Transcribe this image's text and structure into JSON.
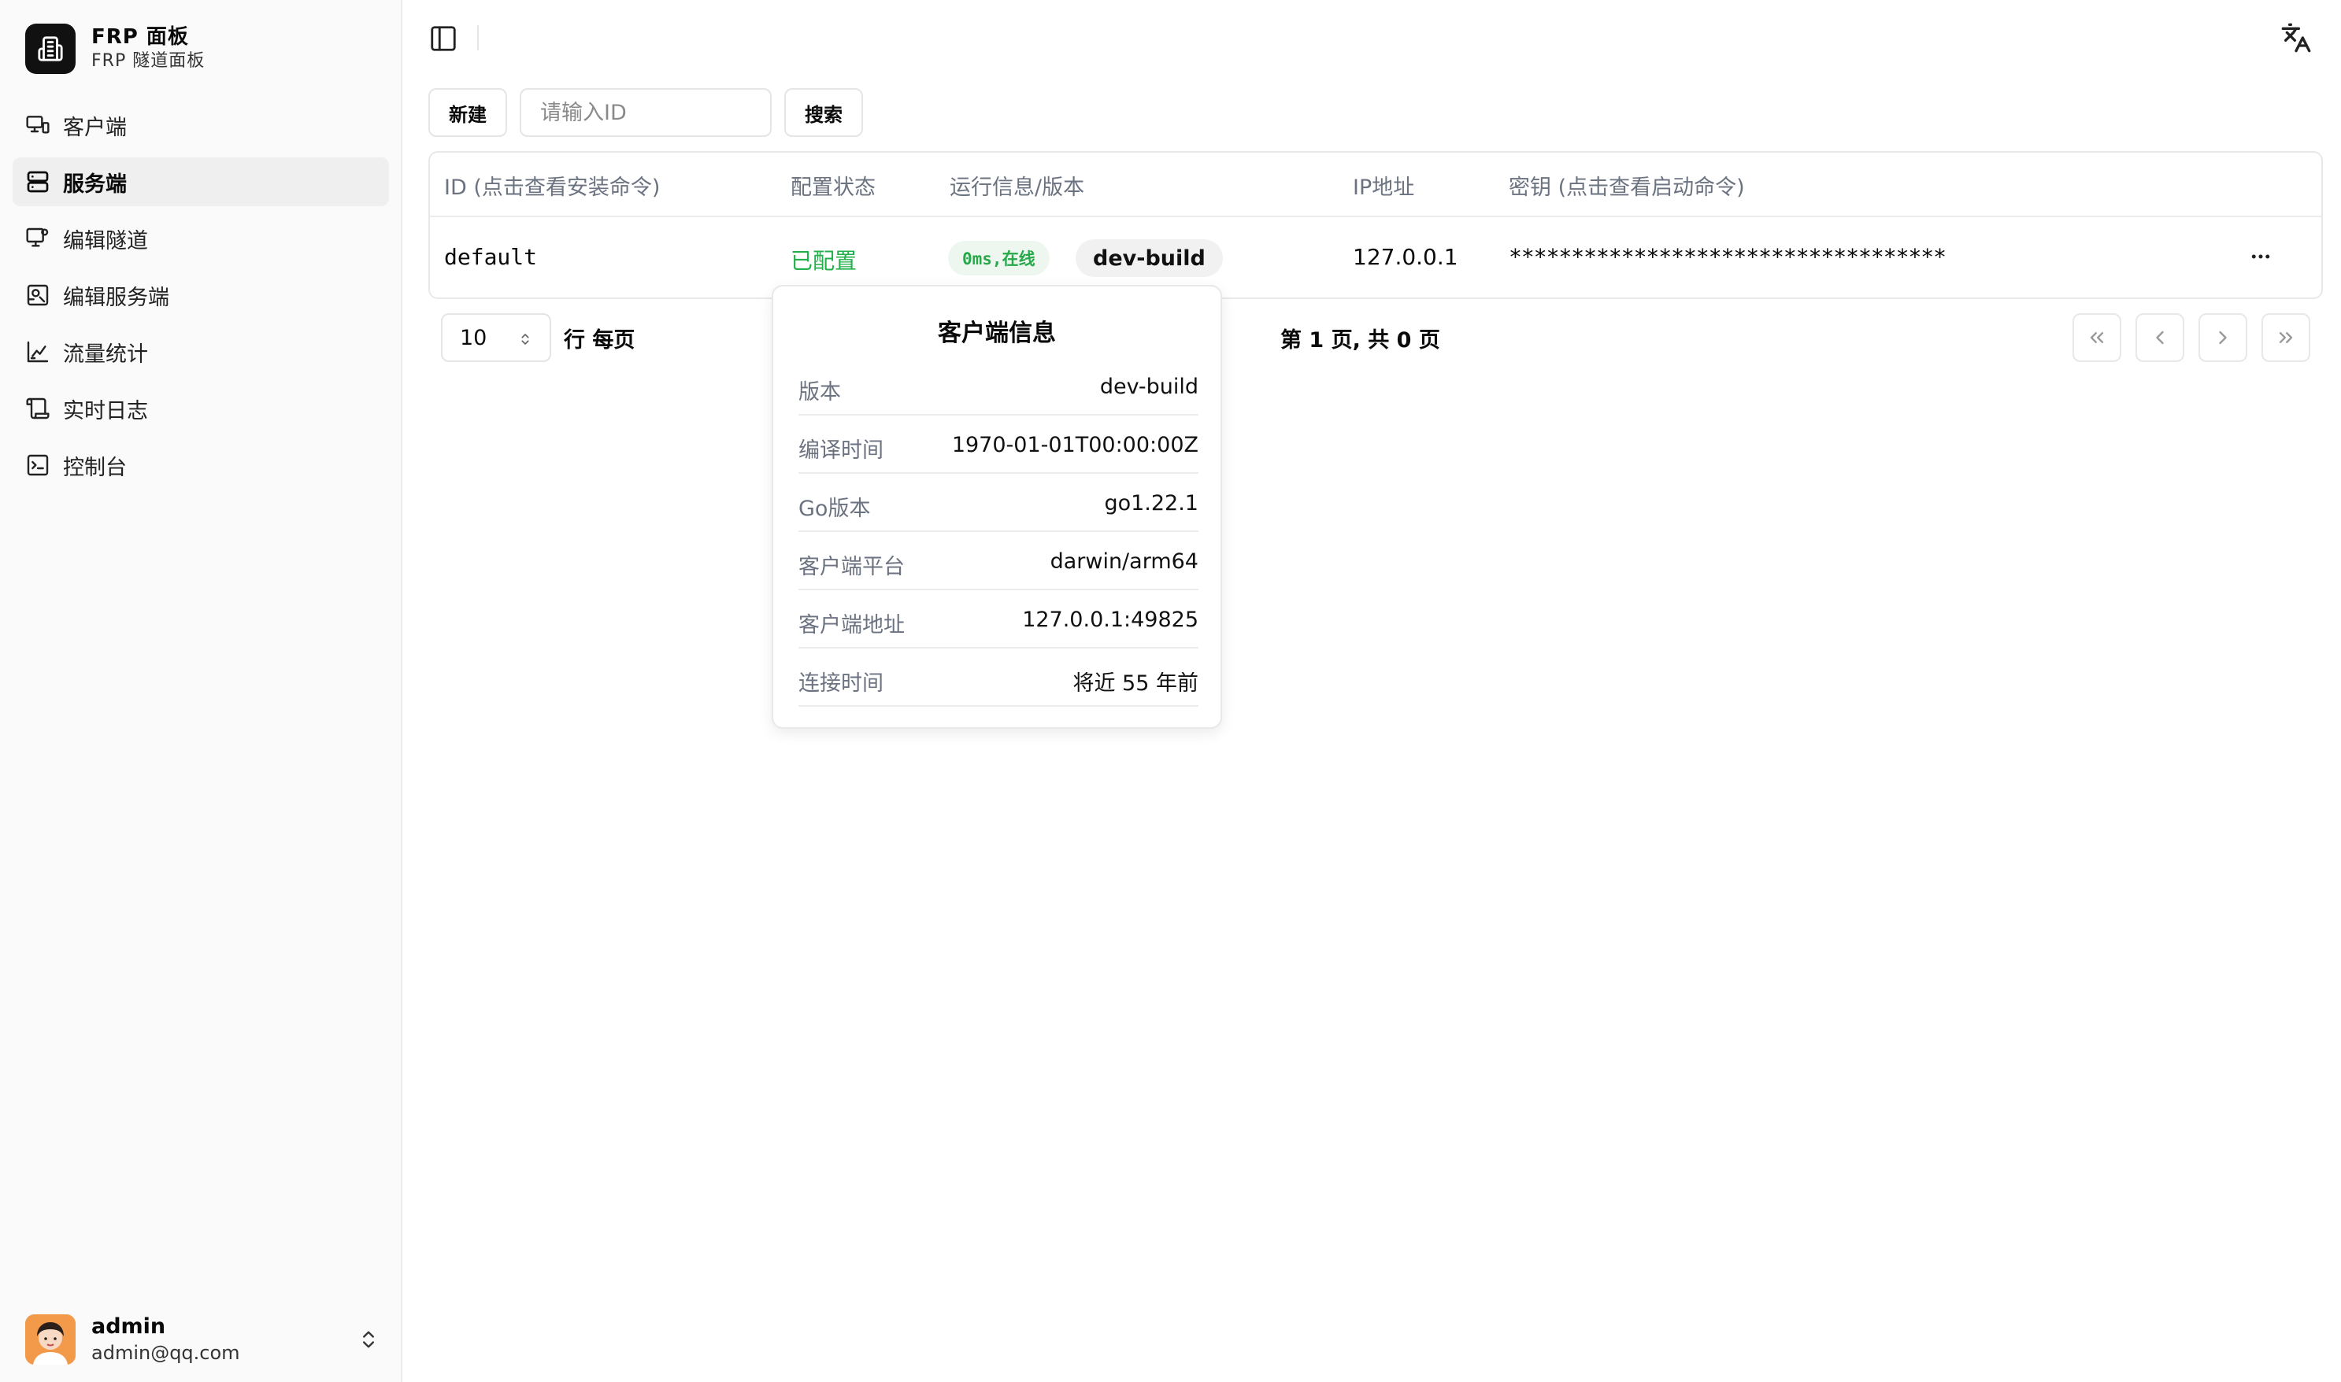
{
  "brand": {
    "title": "FRP  面板",
    "subtitle": "FRP  隧道面板"
  },
  "sidebar": {
    "items": [
      {
        "label": "客户端",
        "icon": "client-icon"
      },
      {
        "label": "服务端",
        "icon": "server-icon"
      },
      {
        "label": "编辑隧道",
        "icon": "edit-tunnel-icon"
      },
      {
        "label": "编辑服务端",
        "icon": "edit-server-icon"
      },
      {
        "label": "流量统计",
        "icon": "chart-icon"
      },
      {
        "label": "实时日志",
        "icon": "log-icon"
      },
      {
        "label": "控制台",
        "icon": "terminal-icon"
      }
    ],
    "active_index": 1
  },
  "user": {
    "name": "admin",
    "email": "admin@qq.com"
  },
  "toolbar": {
    "new_label": "新建",
    "search_placeholder": "请输入ID",
    "search_label": "搜索"
  },
  "table": {
    "headers": {
      "id": "ID (点击查看安装命令)",
      "status": "配置状态",
      "runtime": "运行信息/版本",
      "ip": "IP地址",
      "secret": "密钥 (点击查看启动命令)"
    },
    "rows": [
      {
        "id": "default",
        "status": "已配置",
        "runtime_badge": "0ms,在线",
        "version_badge": "dev-build",
        "ip": "127.0.0.1",
        "secret": "***********************************"
      }
    ]
  },
  "pagination": {
    "page_size": "10",
    "per_page_label": "行 每页",
    "page_info": "第 1 页, 共 0 页"
  },
  "popover": {
    "title": "客户端信息",
    "rows": [
      {
        "key": "版本",
        "value": "dev-build"
      },
      {
        "key": "编译时间",
        "value": "1970-01-01T00:00:00Z"
      },
      {
        "key": "Go版本",
        "value": "go1.22.1"
      },
      {
        "key": "客户端平台",
        "value": "darwin/arm64"
      },
      {
        "key": "客户端地址",
        "value": "127.0.0.1:49825"
      },
      {
        "key": "连接时间",
        "value": "将近 55 年前"
      }
    ]
  },
  "colors": {
    "accent_green": "#22b04b",
    "sidebar_bg": "#fafafa",
    "border": "#e8e8e8"
  }
}
